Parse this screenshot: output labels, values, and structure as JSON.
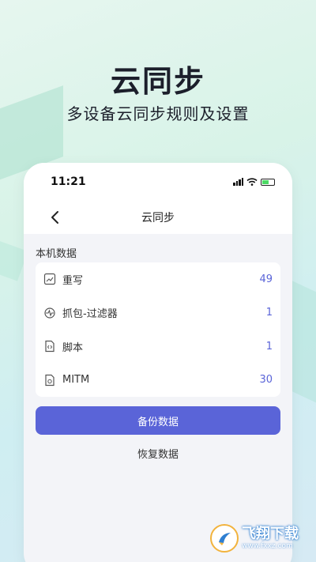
{
  "promo": {
    "title": "云同步",
    "subtitle": "多设备云同步规则及设置"
  },
  "status_bar": {
    "time": "11:21"
  },
  "nav": {
    "title": "云同步"
  },
  "section": {
    "label": "本机数据"
  },
  "items": [
    {
      "label": "重写",
      "count": "49",
      "icon": "rewrite-icon"
    },
    {
      "label": "抓包-过滤器",
      "count": "1",
      "icon": "capture-filter-icon"
    },
    {
      "label": "脚本",
      "count": "1",
      "icon": "script-icon"
    },
    {
      "label": "MITM",
      "count": "30",
      "icon": "mitm-icon"
    }
  ],
  "actions": {
    "backup_label": "备份数据",
    "restore_label": "恢复数据"
  },
  "watermark": {
    "name": "飞翔下载",
    "url": "www.fxxz.com"
  },
  "colors": {
    "accent": "#5a64d8",
    "count_text": "#5a64d8"
  }
}
